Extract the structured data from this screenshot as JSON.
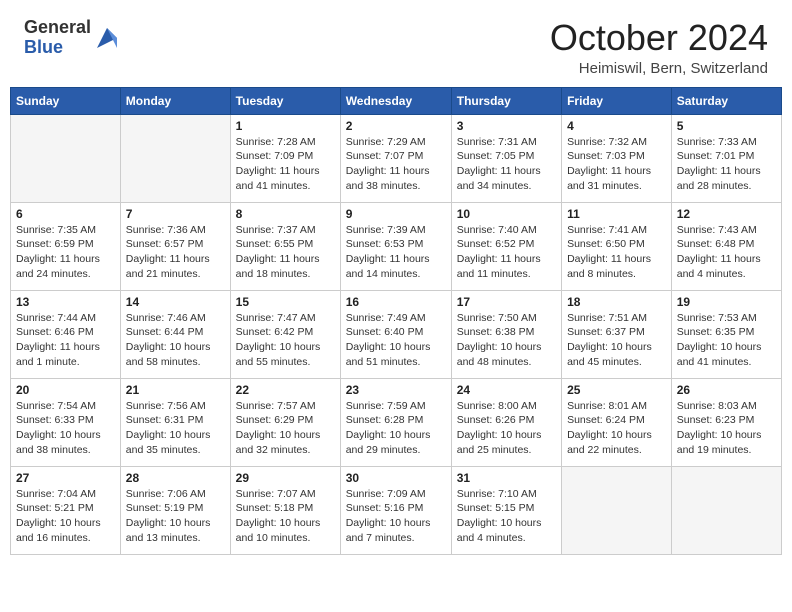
{
  "header": {
    "logo_general": "General",
    "logo_blue": "Blue",
    "month_title": "October 2024",
    "location": "Heimiswil, Bern, Switzerland"
  },
  "days_of_week": [
    "Sunday",
    "Monday",
    "Tuesday",
    "Wednesday",
    "Thursday",
    "Friday",
    "Saturday"
  ],
  "weeks": [
    [
      {
        "day": "",
        "empty": true
      },
      {
        "day": "",
        "empty": true
      },
      {
        "day": "1",
        "sunrise": "7:28 AM",
        "sunset": "7:09 PM",
        "daylight": "11 hours and 41 minutes."
      },
      {
        "day": "2",
        "sunrise": "7:29 AM",
        "sunset": "7:07 PM",
        "daylight": "11 hours and 38 minutes."
      },
      {
        "day": "3",
        "sunrise": "7:31 AM",
        "sunset": "7:05 PM",
        "daylight": "11 hours and 34 minutes."
      },
      {
        "day": "4",
        "sunrise": "7:32 AM",
        "sunset": "7:03 PM",
        "daylight": "11 hours and 31 minutes."
      },
      {
        "day": "5",
        "sunrise": "7:33 AM",
        "sunset": "7:01 PM",
        "daylight": "11 hours and 28 minutes."
      }
    ],
    [
      {
        "day": "6",
        "sunrise": "7:35 AM",
        "sunset": "6:59 PM",
        "daylight": "11 hours and 24 minutes."
      },
      {
        "day": "7",
        "sunrise": "7:36 AM",
        "sunset": "6:57 PM",
        "daylight": "11 hours and 21 minutes."
      },
      {
        "day": "8",
        "sunrise": "7:37 AM",
        "sunset": "6:55 PM",
        "daylight": "11 hours and 18 minutes."
      },
      {
        "day": "9",
        "sunrise": "7:39 AM",
        "sunset": "6:53 PM",
        "daylight": "11 hours and 14 minutes."
      },
      {
        "day": "10",
        "sunrise": "7:40 AM",
        "sunset": "6:52 PM",
        "daylight": "11 hours and 11 minutes."
      },
      {
        "day": "11",
        "sunrise": "7:41 AM",
        "sunset": "6:50 PM",
        "daylight": "11 hours and 8 minutes."
      },
      {
        "day": "12",
        "sunrise": "7:43 AM",
        "sunset": "6:48 PM",
        "daylight": "11 hours and 4 minutes."
      }
    ],
    [
      {
        "day": "13",
        "sunrise": "7:44 AM",
        "sunset": "6:46 PM",
        "daylight": "11 hours and 1 minute."
      },
      {
        "day": "14",
        "sunrise": "7:46 AM",
        "sunset": "6:44 PM",
        "daylight": "10 hours and 58 minutes."
      },
      {
        "day": "15",
        "sunrise": "7:47 AM",
        "sunset": "6:42 PM",
        "daylight": "10 hours and 55 minutes."
      },
      {
        "day": "16",
        "sunrise": "7:49 AM",
        "sunset": "6:40 PM",
        "daylight": "10 hours and 51 minutes."
      },
      {
        "day": "17",
        "sunrise": "7:50 AM",
        "sunset": "6:38 PM",
        "daylight": "10 hours and 48 minutes."
      },
      {
        "day": "18",
        "sunrise": "7:51 AM",
        "sunset": "6:37 PM",
        "daylight": "10 hours and 45 minutes."
      },
      {
        "day": "19",
        "sunrise": "7:53 AM",
        "sunset": "6:35 PM",
        "daylight": "10 hours and 41 minutes."
      }
    ],
    [
      {
        "day": "20",
        "sunrise": "7:54 AM",
        "sunset": "6:33 PM",
        "daylight": "10 hours and 38 minutes."
      },
      {
        "day": "21",
        "sunrise": "7:56 AM",
        "sunset": "6:31 PM",
        "daylight": "10 hours and 35 minutes."
      },
      {
        "day": "22",
        "sunrise": "7:57 AM",
        "sunset": "6:29 PM",
        "daylight": "10 hours and 32 minutes."
      },
      {
        "day": "23",
        "sunrise": "7:59 AM",
        "sunset": "6:28 PM",
        "daylight": "10 hours and 29 minutes."
      },
      {
        "day": "24",
        "sunrise": "8:00 AM",
        "sunset": "6:26 PM",
        "daylight": "10 hours and 25 minutes."
      },
      {
        "day": "25",
        "sunrise": "8:01 AM",
        "sunset": "6:24 PM",
        "daylight": "10 hours and 22 minutes."
      },
      {
        "day": "26",
        "sunrise": "8:03 AM",
        "sunset": "6:23 PM",
        "daylight": "10 hours and 19 minutes."
      }
    ],
    [
      {
        "day": "27",
        "sunrise": "7:04 AM",
        "sunset": "5:21 PM",
        "daylight": "10 hours and 16 minutes."
      },
      {
        "day": "28",
        "sunrise": "7:06 AM",
        "sunset": "5:19 PM",
        "daylight": "10 hours and 13 minutes."
      },
      {
        "day": "29",
        "sunrise": "7:07 AM",
        "sunset": "5:18 PM",
        "daylight": "10 hours and 10 minutes."
      },
      {
        "day": "30",
        "sunrise": "7:09 AM",
        "sunset": "5:16 PM",
        "daylight": "10 hours and 7 minutes."
      },
      {
        "day": "31",
        "sunrise": "7:10 AM",
        "sunset": "5:15 PM",
        "daylight": "10 hours and 4 minutes."
      },
      {
        "day": "",
        "empty": true
      },
      {
        "day": "",
        "empty": true
      }
    ]
  ],
  "labels": {
    "sunrise": "Sunrise:",
    "sunset": "Sunset:",
    "daylight": "Daylight:"
  }
}
